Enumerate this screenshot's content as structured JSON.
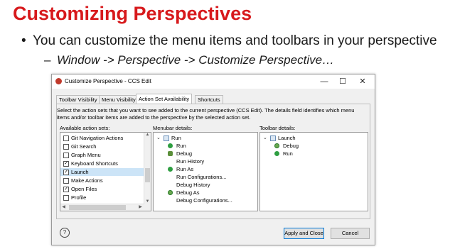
{
  "slide": {
    "title": "Customizing Perspectives",
    "bullet1": "You can customize the menu items and toolbars in your perspective",
    "bullet2": "Window -> Perspective -> Customize Perspective…",
    "bullet1_marker": "•",
    "bullet2_marker": "–"
  },
  "dialog": {
    "title": "Customize Perspective - CCS Edit",
    "window_controls": {
      "minimize": "—",
      "maximize": "☐",
      "close": "✕"
    },
    "tabs": [
      "Toolbar Visibility",
      "Menu Visibility",
      "Action Set Availability",
      "Shortcuts"
    ],
    "active_tab": "Action Set Availability",
    "description": "Select the action sets that you want to see added to the current perspective (CCS Edit). The details field identifies which menu items and/or toolbar items are added to the perspective by the selected action set.",
    "available_label": "Available action sets:",
    "menubar_label": "Menubar details:",
    "toolbar_label": "Toolbar details:",
    "action_sets": [
      {
        "label": "Git Navigation Actions",
        "checked": false,
        "selected": false
      },
      {
        "label": "Git Search",
        "checked": false,
        "selected": false
      },
      {
        "label": "Graph Menu",
        "checked": false,
        "selected": false
      },
      {
        "label": "Keyboard Shortcuts",
        "checked": true,
        "selected": false
      },
      {
        "label": "Launch",
        "checked": true,
        "selected": true
      },
      {
        "label": "Make Actions",
        "checked": false,
        "selected": false
      },
      {
        "label": "Open Files",
        "checked": true,
        "selected": false
      },
      {
        "label": "Profile",
        "checked": false,
        "selected": false
      }
    ],
    "menubar_items": [
      {
        "label": "Run",
        "icon": "document-icon",
        "level": 0,
        "expander": true
      },
      {
        "label": "Run",
        "icon": "run-icon",
        "level": 1
      },
      {
        "label": "Debug",
        "icon": "debug-icon",
        "level": 1
      },
      {
        "label": "Run History",
        "icon": "",
        "level": 1
      },
      {
        "label": "Run As",
        "icon": "run-as-icon",
        "level": 1
      },
      {
        "label": "Run Configurations...",
        "icon": "",
        "level": 1
      },
      {
        "label": "Debug History",
        "icon": "",
        "level": 1
      },
      {
        "label": "Debug As",
        "icon": "debug-as-icon",
        "level": 1
      },
      {
        "label": "Debug Configurations...",
        "icon": "",
        "level": 1
      }
    ],
    "toolbar_items": [
      {
        "label": "Launch",
        "icon": "toolbar-icon",
        "level": 0,
        "expander": true
      },
      {
        "label": "Debug",
        "icon": "debug-icon",
        "level": 1
      },
      {
        "label": "Run",
        "icon": "run-icon",
        "level": 1
      }
    ],
    "buttons": {
      "apply": "Apply and Close",
      "cancel": "Cancel",
      "help": "?"
    },
    "scroll_arrows": {
      "up": "▲",
      "down": "▼",
      "left": "◀",
      "right": "▶"
    },
    "check_mark": "✓",
    "expander_glyph": "⌄"
  }
}
